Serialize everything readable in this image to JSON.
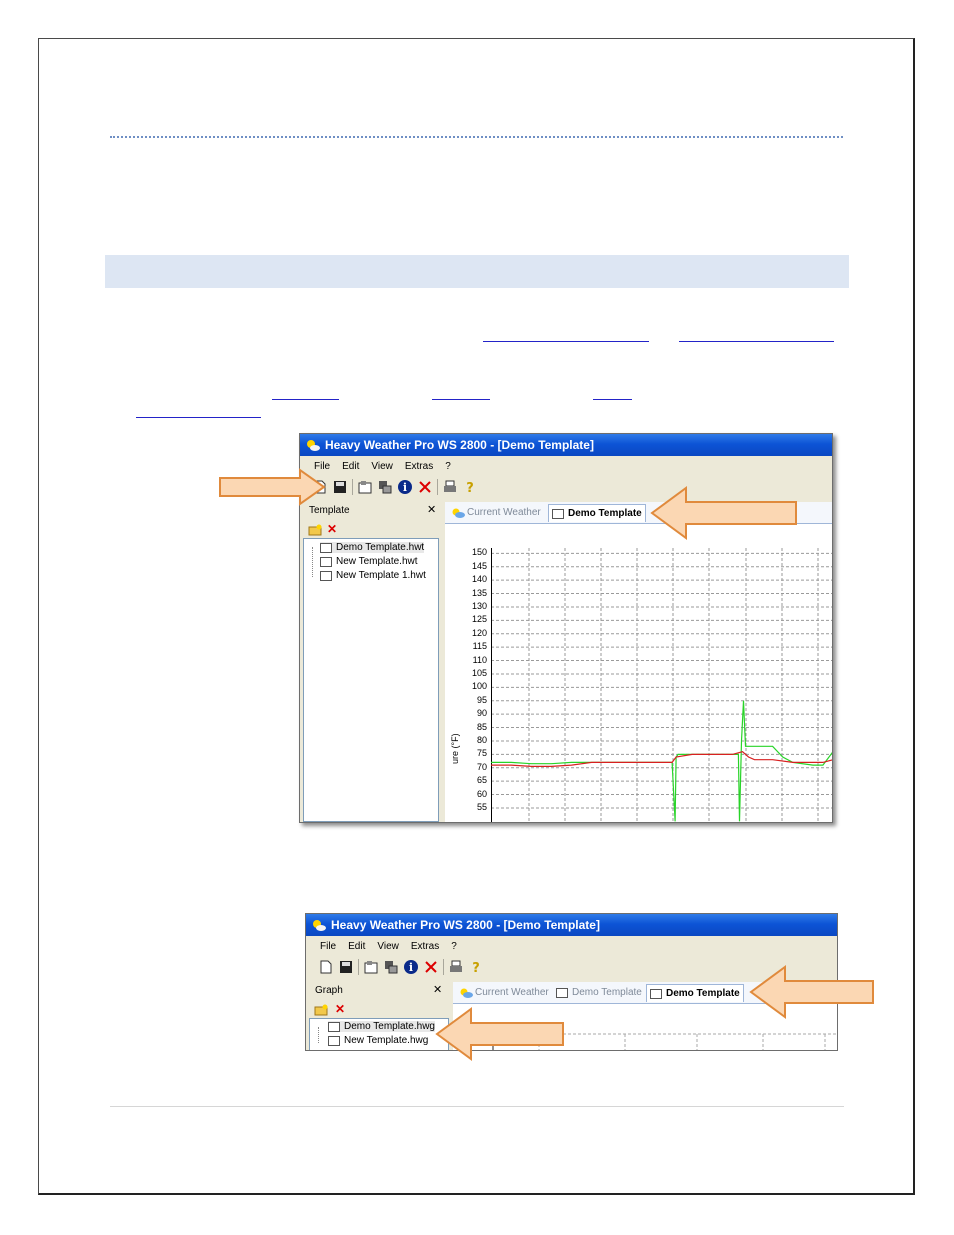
{
  "screenshot1": {
    "window_title": "Heavy Weather Pro WS 2800 - [Demo Template]",
    "menu": [
      "File",
      "Edit",
      "View",
      "Extras",
      "?"
    ],
    "panel_title": "Template",
    "files": [
      "Demo Template.hwt",
      "New Template.hwt",
      "New Template 1.hwt"
    ],
    "tabs": [
      "Current Weather",
      "Demo Template"
    ],
    "y_ticks": [
      "150",
      "145",
      "140",
      "135",
      "130",
      "125",
      "120",
      "115",
      "110",
      "105",
      "100",
      "95",
      "90",
      "85",
      "80",
      "75",
      "70",
      "65",
      "60",
      "55"
    ],
    "y_label": "ure (°F)"
  },
  "screenshot2": {
    "window_title": "Heavy Weather Pro WS 2800 - [Demo Template]",
    "menu": [
      "File",
      "Edit",
      "View",
      "Extras",
      "?"
    ],
    "panel_title": "Graph",
    "files": [
      "Demo Template.hwg",
      "New Template.hwg"
    ],
    "tabs": [
      "Current Weather",
      "Demo Template",
      "Demo Template"
    ]
  },
  "colors": {
    "title_bar": "#0d54d6",
    "band": "#dde6f3",
    "arrow_fill": "#fbd7b3",
    "arrow_stroke": "#e08a3c",
    "series_green": "#28d428",
    "series_red": "#d82020"
  },
  "chart_data": {
    "type": "line",
    "ylabel": "ure (°F)",
    "ylim": [
      52,
      152
    ],
    "y_ticks": [
      150,
      145,
      140,
      135,
      130,
      125,
      120,
      115,
      110,
      105,
      100,
      95,
      90,
      85,
      80,
      75,
      70,
      65,
      60,
      55
    ],
    "series": [
      {
        "color": "#28d428",
        "x": [
          0,
          20,
          40,
          60,
          80,
          100,
          120,
          140,
          160,
          180,
          183,
          184,
          186,
          190,
          200,
          220,
          240,
          246,
          247,
          249,
          251,
          253,
          255,
          258,
          280,
          290,
          300,
          320,
          330,
          338,
          340
        ],
        "y": [
          72,
          72,
          71.5,
          71.5,
          72,
          72,
          72,
          72,
          72,
          72,
          50,
          74,
          75,
          75,
          75,
          75,
          75,
          75,
          50,
          80,
          95,
          78,
          78,
          78,
          78,
          74,
          72,
          71,
          71,
          75,
          76
        ]
      },
      {
        "color": "#d82020",
        "x": [
          0,
          20,
          40,
          60,
          80,
          100,
          120,
          140,
          160,
          180,
          184,
          200,
          220,
          240,
          250,
          256,
          262,
          280,
          300,
          320,
          330,
          340
        ],
        "y": [
          71,
          71,
          70.5,
          70.5,
          71,
          72,
          72,
          72,
          72,
          72,
          74,
          75,
          75,
          75,
          76,
          74,
          73,
          73,
          72,
          72,
          72,
          73
        ]
      }
    ]
  }
}
